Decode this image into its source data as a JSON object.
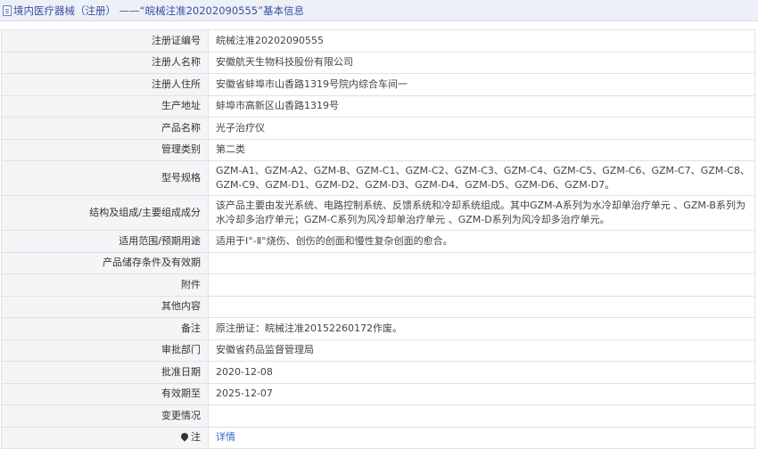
{
  "header": {
    "title": "境内医疗器械（注册） ——“皖械注准20202090555”基本信息"
  },
  "rows": [
    {
      "label": "注册证编号",
      "value": "皖械注准20202090555"
    },
    {
      "label": "注册人名称",
      "value": "安徽航天生物科技股份有限公司"
    },
    {
      "label": "注册人住所",
      "value": "安徽省蚌埠市山香路1319号院内综合车间一"
    },
    {
      "label": "生产地址",
      "value": "蚌埠市高新区山香路1319号"
    },
    {
      "label": "产品名称",
      "value": "光子治疗仪"
    },
    {
      "label": "管理类别",
      "value": "第二类"
    },
    {
      "label": "型号规格",
      "value": "GZM-A1、GZM-A2、GZM-B、GZM-C1、GZM-C2、GZM-C3、GZM-C4、GZM-C5、GZM-C6、GZM-C7、GZM-C8、GZM-C9、GZM-D1、GZM-D2、GZM-D3、GZM-D4、GZM-D5、GZM-D6、GZM-D7。"
    },
    {
      "label": "结构及组成/主要组成成分",
      "value": "该产品主要由发光系统、电路控制系统、反馈系统和冷却系统组成。其中GZM-A系列为水冷却单治疗单元 、GZM-B系列为水冷却多治疗单元；GZM-C系列为风冷却单治疗单元 、GZM-D系列为风冷却多治疗单元。"
    },
    {
      "label": "适用范围/预期用途",
      "value": "适用于Ⅰ°-Ⅱ°烧伤、创伤的创面和慢性复杂创面的愈合。"
    },
    {
      "label": "产品储存条件及有效期",
      "value": ""
    },
    {
      "label": "附件",
      "value": ""
    },
    {
      "label": "其他内容",
      "value": ""
    },
    {
      "label": "备注",
      "value": "原注册证：皖械注准20152260172作废。"
    },
    {
      "label": "审批部门",
      "value": "安徽省药品监督管理局"
    },
    {
      "label": "批准日期",
      "value": "2020-12-08"
    },
    {
      "label": "有效期至",
      "value": "2025-12-07"
    },
    {
      "label": "变更情况",
      "value": ""
    }
  ],
  "note_row": {
    "label": "注",
    "link_text": "详情",
    "icon": "pin-icon"
  }
}
